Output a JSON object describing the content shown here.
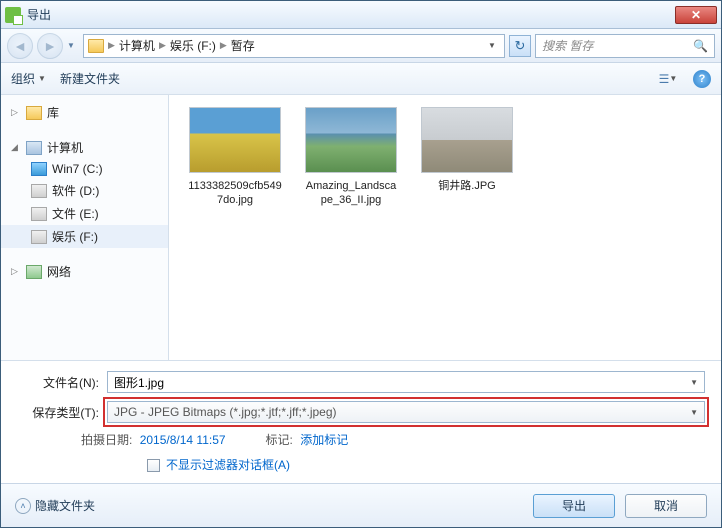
{
  "window": {
    "title": "导出"
  },
  "nav": {
    "breadcrumb": [
      "计算机",
      "娱乐 (F:)",
      "暂存"
    ],
    "search_placeholder": "搜索 暂存"
  },
  "toolbar": {
    "organize": "组织",
    "newfolder": "新建文件夹"
  },
  "sidebar": {
    "library": "库",
    "computer": "计算机",
    "drives": [
      {
        "label": "Win7 (C:)",
        "type": "win"
      },
      {
        "label": "软件 (D:)",
        "type": "drv"
      },
      {
        "label": "文件 (E:)",
        "type": "drv"
      },
      {
        "label": "娱乐 (F:)",
        "type": "drv",
        "selected": true
      }
    ],
    "network": "网络"
  },
  "files": [
    {
      "name": "1133382509cfb5497do.jpg",
      "cls": "sunflower"
    },
    {
      "name": "Amazing_Landscape_36_II.jpg",
      "cls": "landscape"
    },
    {
      "name": "铜井路.JPG",
      "cls": "road"
    }
  ],
  "form": {
    "filename_label": "文件名(N):",
    "filename_value": "图形1.jpg",
    "type_label": "保存类型(T):",
    "type_value": "JPG - JPEG Bitmaps (*.jpg;*.jtf;*.jff;*.jpeg)",
    "date_label": "拍摄日期:",
    "date_value": "2015/8/14 11:57",
    "tags_label": "标记:",
    "tags_value": "添加标记",
    "filter_checkbox": "不显示过滤器对话框(A)"
  },
  "footer": {
    "hide": "隐藏文件夹",
    "export": "导出",
    "cancel": "取消"
  }
}
